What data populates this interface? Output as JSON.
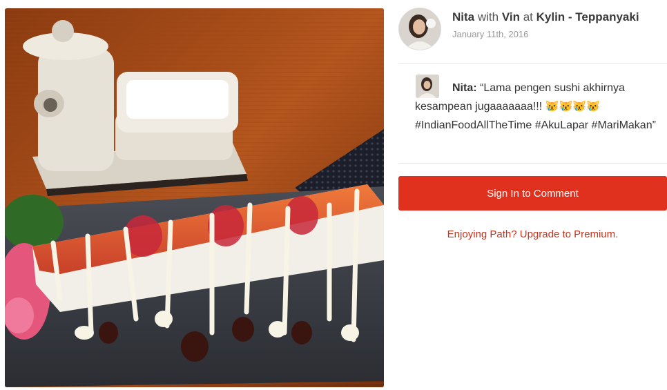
{
  "post": {
    "author": "Nita",
    "with_word": "with",
    "companion": "Vin",
    "at_word": "at",
    "place": "Kylin - Teppanyaki",
    "date": "January 11th, 2016"
  },
  "comment": {
    "author": "Nita:",
    "text": "“Lama pengen sushi akhirnya kesampean jugaaaaaaa!!! 😿😿😿😿 #IndianFoodAllTheTime #AkuLapar #MariMakan”"
  },
  "actions": {
    "sign_in_label": "Sign In to Comment",
    "upgrade_label": "Enjoying Path? Upgrade to Premium."
  },
  "colors": {
    "accent": "#e0301e",
    "link": "#c7321d"
  },
  "icons": {
    "author_avatar": "avatar-photo",
    "commenter_avatar": "avatar-photo"
  }
}
